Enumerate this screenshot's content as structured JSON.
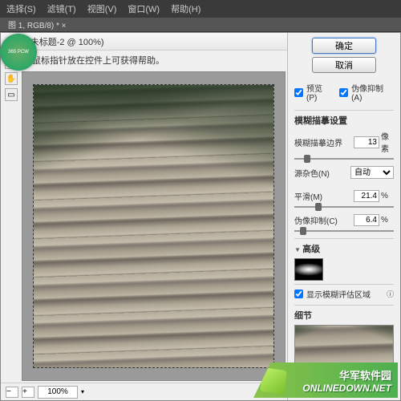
{
  "menubar": {
    "items": [
      "选择(S)",
      "滤镜(T)",
      "视图(V)",
      "窗口(W)",
      "帮助(H)"
    ]
  },
  "doc_tab": "图 1, RGB/8) * ×",
  "dialog": {
    "title": "防抖 (未标题-2 @ 100%)",
    "hint": "将鼠标指针放在控件上可获得帮助。",
    "ok": "确定",
    "cancel": "取消",
    "preview_label": "预览(P)",
    "artifact_label": "伪像抑制(A)"
  },
  "section": {
    "blur_trace": "模糊描摹设置",
    "advanced": "高级",
    "show_regions": "显示模糊评估区域",
    "detail": "细节"
  },
  "params": {
    "bounds": {
      "label": "模糊描摹边界",
      "value": "13",
      "unit": "像素"
    },
    "noise": {
      "label": "源杂色(N)",
      "value": "自动"
    },
    "smooth": {
      "label": "平滑(M)",
      "value": "21.4",
      "unit": "%"
    },
    "artifact": {
      "label": "伪像抑制(C)",
      "value": "6.4",
      "unit": "%"
    }
  },
  "zoom": "100%",
  "watermark": {
    "cn": "华军软件园",
    "en": "ONLINEDOWN.NET"
  },
  "badge": "365 PCW"
}
